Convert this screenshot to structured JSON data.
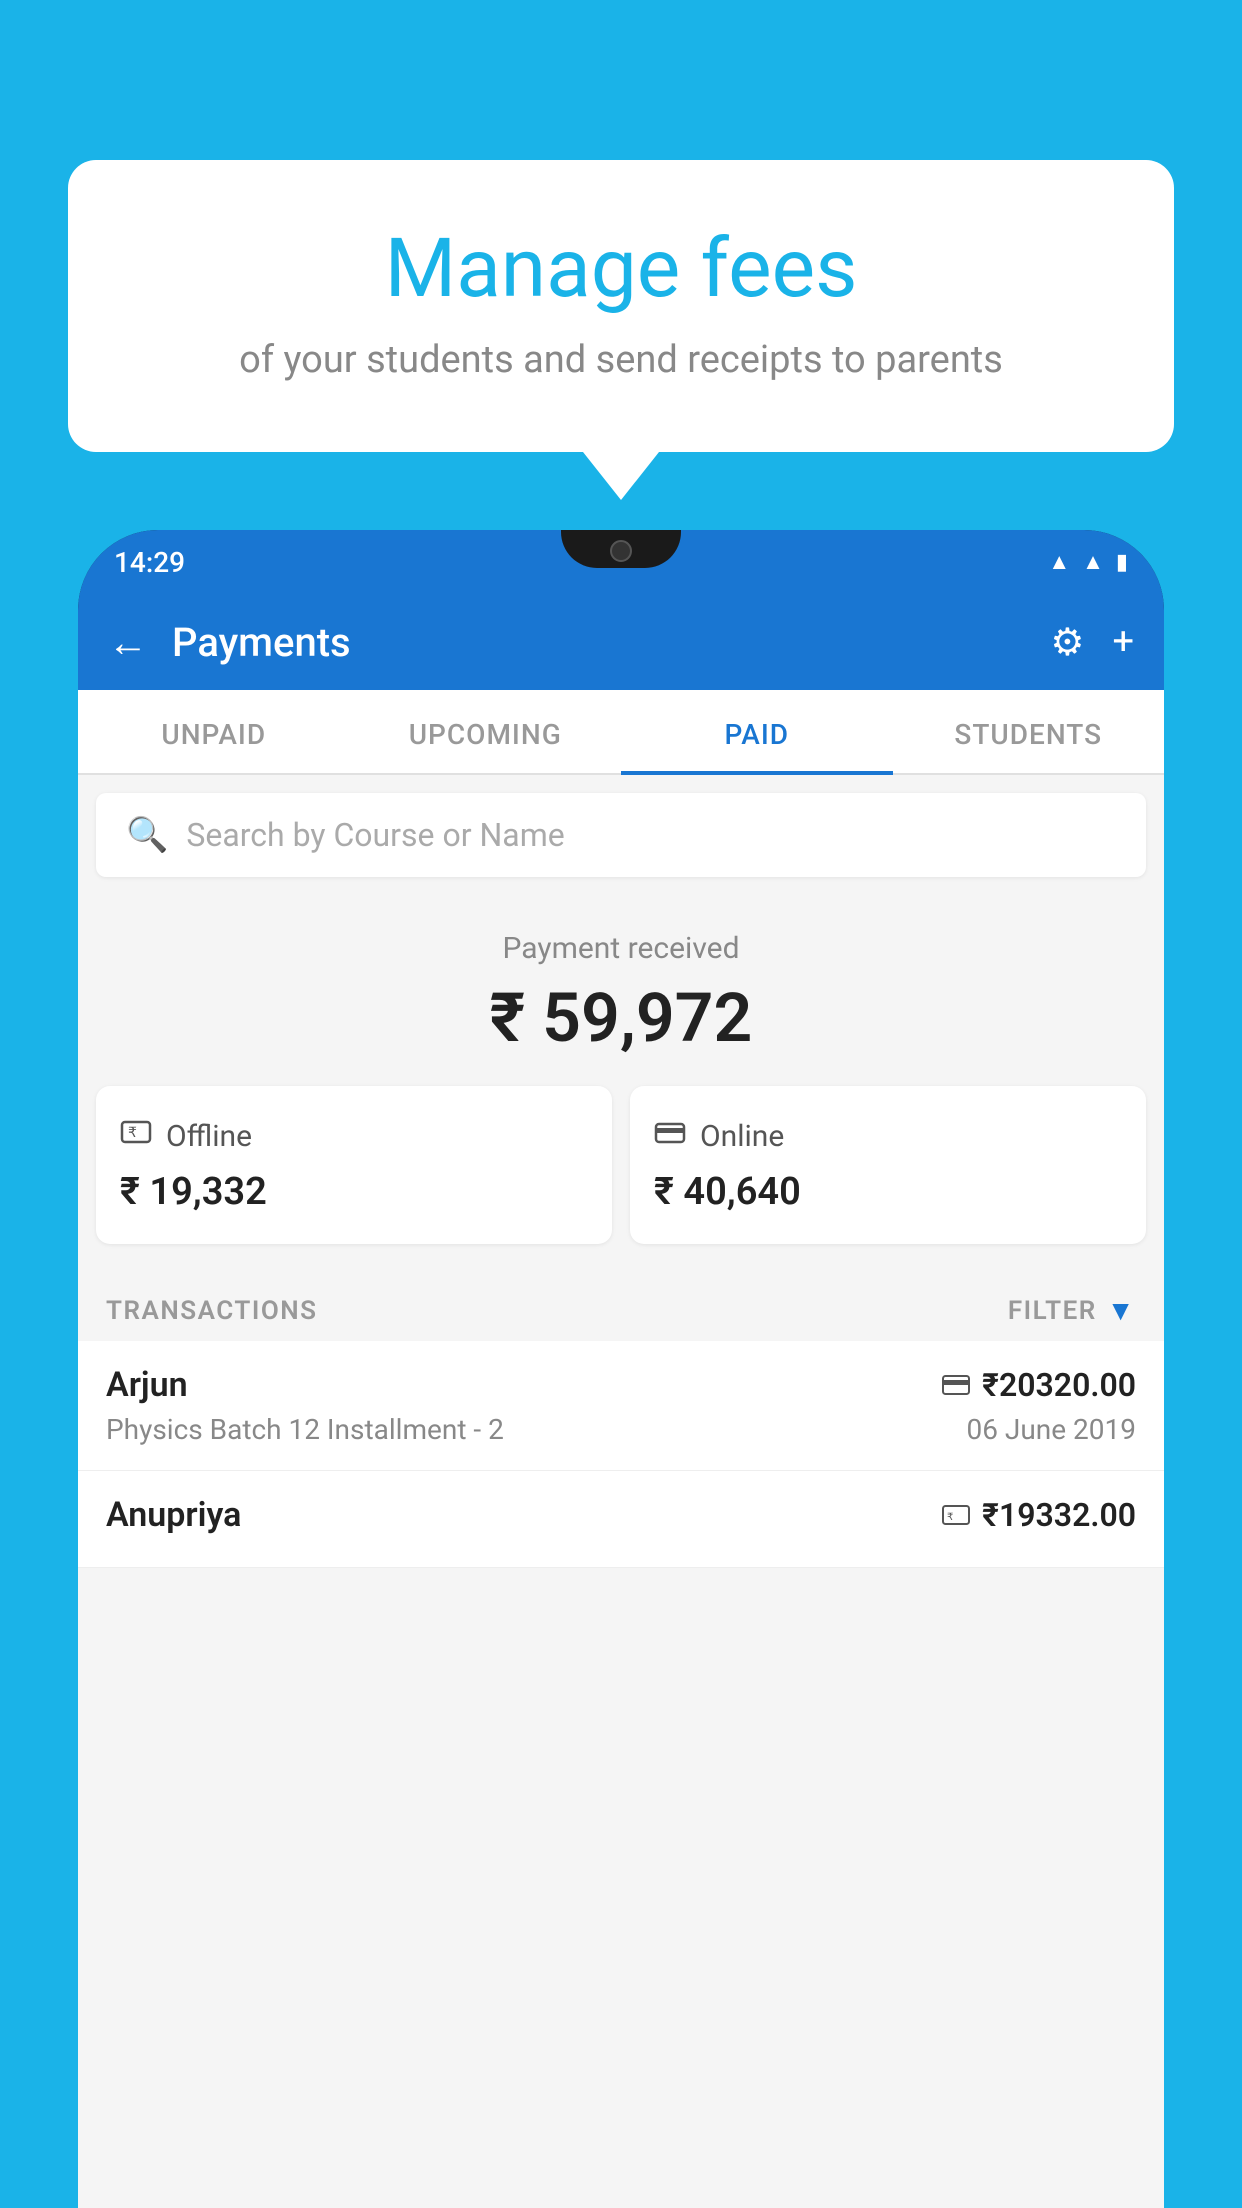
{
  "background": {
    "color": "#1ab3e8"
  },
  "speech_bubble": {
    "title": "Manage fees",
    "subtitle": "of your students and send receipts to parents"
  },
  "status_bar": {
    "time": "14:29",
    "icons": [
      "wifi",
      "signal",
      "battery"
    ]
  },
  "app_header": {
    "title": "Payments",
    "back_label": "←",
    "settings_icon": "⚙",
    "add_icon": "+"
  },
  "tabs": [
    {
      "label": "UNPAID",
      "active": false
    },
    {
      "label": "UPCOMING",
      "active": false
    },
    {
      "label": "PAID",
      "active": true
    },
    {
      "label": "STUDENTS",
      "active": false
    }
  ],
  "search": {
    "placeholder": "Search by Course or Name"
  },
  "payment_received": {
    "label": "Payment received",
    "amount": "₹ 59,972"
  },
  "payment_methods": [
    {
      "type": "Offline",
      "icon": "💳",
      "amount": "₹ 19,332"
    },
    {
      "type": "Online",
      "icon": "💳",
      "amount": "₹ 40,640"
    }
  ],
  "transactions_section": {
    "label": "TRANSACTIONS",
    "filter_label": "FILTER"
  },
  "transactions": [
    {
      "name": "Arjun",
      "course": "Physics Batch 12 Installment - 2",
      "amount": "₹20320.00",
      "date": "06 June 2019",
      "payment_type": "online"
    },
    {
      "name": "Anupriya",
      "course": "",
      "amount": "₹19332.00",
      "date": "",
      "payment_type": "offline"
    }
  ]
}
